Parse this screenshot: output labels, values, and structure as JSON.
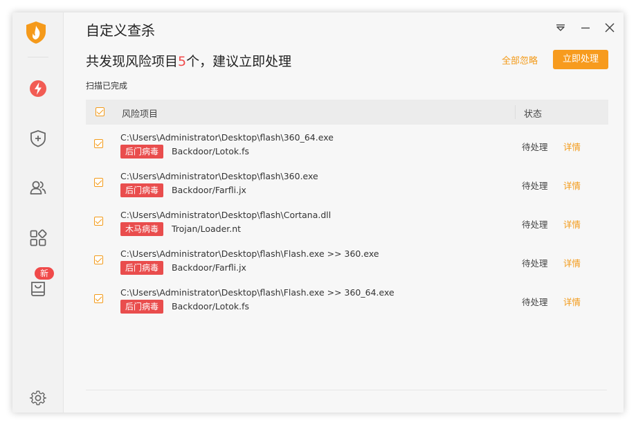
{
  "window": {
    "title": "自定义查杀"
  },
  "sidebar": {
    "items": [
      {
        "name": "speedup",
        "icon": "lightning-icon"
      },
      {
        "name": "protection",
        "icon": "shield-plus-icon"
      },
      {
        "name": "users",
        "icon": "users-icon"
      },
      {
        "name": "apps",
        "icon": "apps-grid-icon"
      },
      {
        "name": "toolbox",
        "icon": "bag-icon",
        "badge": "新"
      }
    ],
    "settings_icon": "gear-icon"
  },
  "summary": {
    "prefix": "共发现风险项目",
    "count": "5",
    "suffix": "个，建议立即处理",
    "ignore_all": "全部忽略",
    "handle_now": "立即处理",
    "scan_status": "扫描已完成"
  },
  "table": {
    "columns": {
      "name": "风险项目",
      "status": "状态"
    },
    "rows": [
      {
        "path": "C:\\Users\\Administrator\\Desktop\\flash\\360_64.exe",
        "tag": "后门病毒",
        "virus": "Backdoor/Lotok.fs",
        "status": "待处理",
        "action": "详情"
      },
      {
        "path": "C:\\Users\\Administrator\\Desktop\\flash\\360.exe",
        "tag": "后门病毒",
        "virus": "Backdoor/Farfli.jx",
        "status": "待处理",
        "action": "详情"
      },
      {
        "path": "C:\\Users\\Administrator\\Desktop\\flash\\Cortana.dll",
        "tag": "木马病毒",
        "virus": "Trojan/Loader.nt",
        "status": "待处理",
        "action": "详情"
      },
      {
        "path": "C:\\Users\\Administrator\\Desktop\\flash\\Flash.exe >> 360.exe",
        "tag": "后门病毒",
        "virus": "Backdoor/Farfli.jx",
        "status": "待处理",
        "action": "详情"
      },
      {
        "path": "C:\\Users\\Administrator\\Desktop\\flash\\Flash.exe >> 360_64.exe",
        "tag": "后门病毒",
        "virus": "Backdoor/Lotok.fs",
        "status": "待处理",
        "action": "详情"
      }
    ]
  },
  "colors": {
    "accent": "#f79b1e",
    "danger": "#e94d4d",
    "count": "#f04a4a"
  }
}
